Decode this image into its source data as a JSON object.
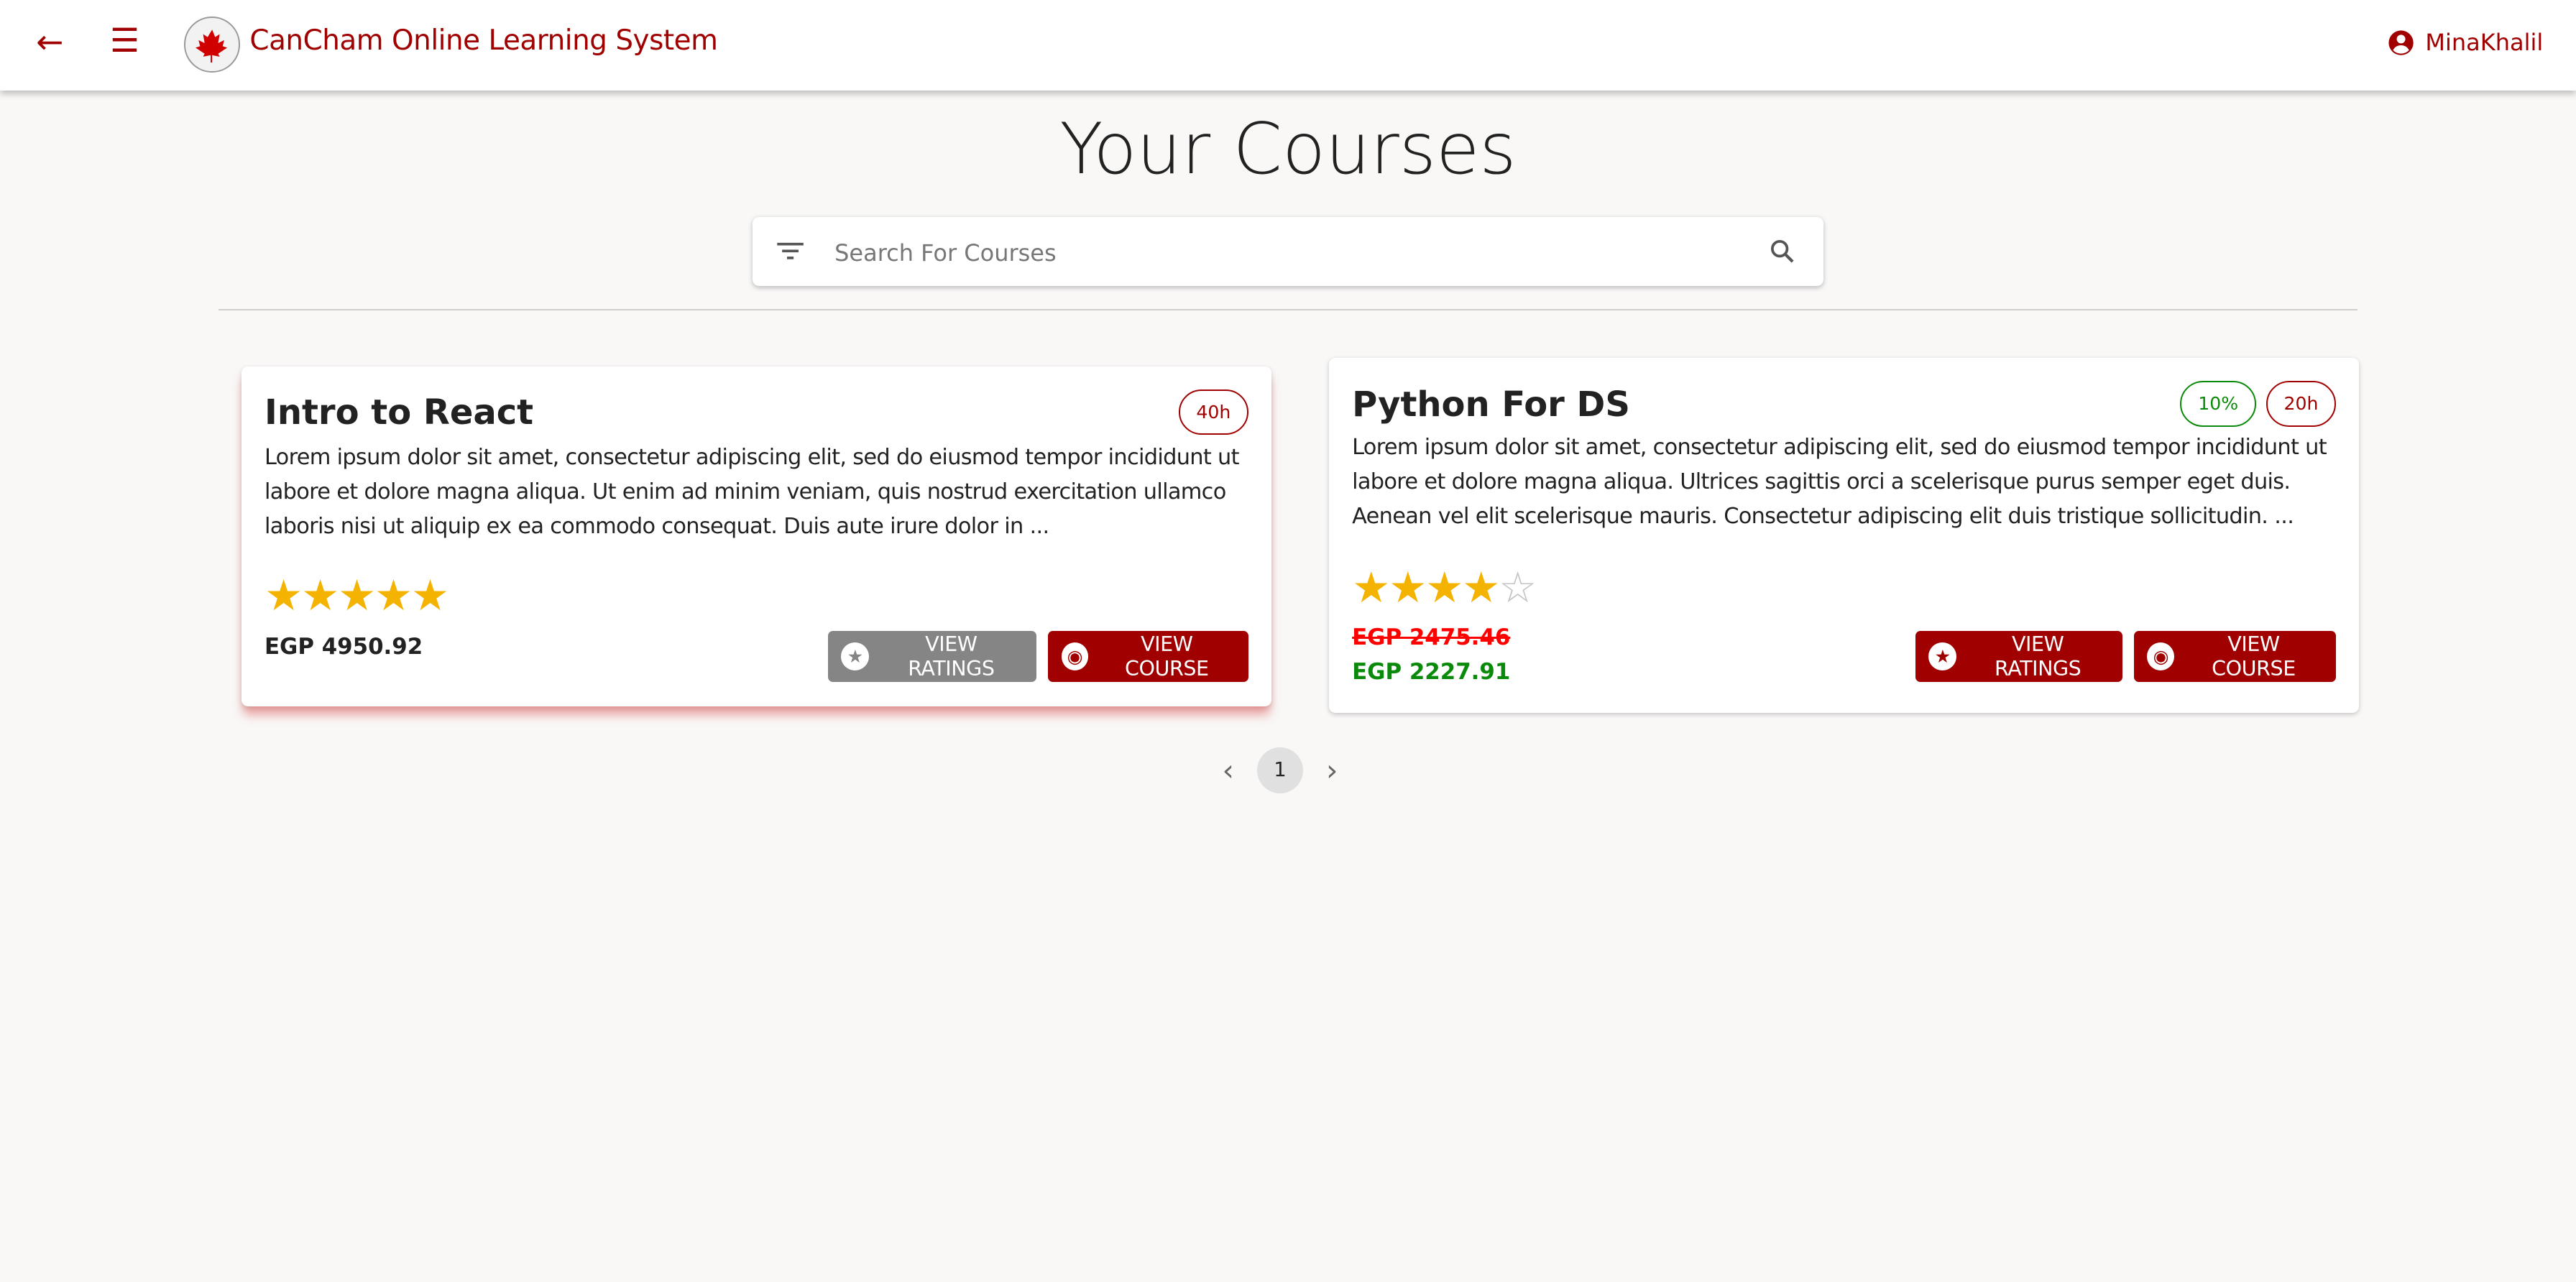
{
  "header": {
    "title": "CanCham Online Learning System",
    "logo_text": "CanCham",
    "user": "MinaKhalil",
    "icons": [
      "arrow-back-icon",
      "menu-icon",
      "account-circle-icon"
    ]
  },
  "page": {
    "title": "Your Courses",
    "search_placeholder": "Search For Courses",
    "search_value": ""
  },
  "courses": [
    {
      "title": "Intro to React",
      "hours": "40h",
      "description": "Lorem ipsum dolor sit amet, consectetur adipiscing elit, sed do eiusmod tempor incididunt ut labore et dolore magna aliqua. Ut enim ad minim veniam, quis nostrud exercitation ullamco laboris nisi ut aliquip ex ea commodo consequat. Duis aute irure dolor in ...",
      "rating": 5,
      "price": "EGP 4950.92",
      "view_ratings": "VIEW RATINGS",
      "view_course": "VIEW COURSE"
    },
    {
      "title": "Python For DS",
      "discount": "10%",
      "hours": "20h",
      "description": "Lorem ipsum dolor sit amet, consectetur adipiscing elit, sed do eiusmod tempor incididunt ut labore et dolore magna aliqua. Ultrices sagittis orci a scelerisque purus semper eget duis. Aenean vel elit scelerisque mauris. Consectetur adipiscing elit duis tristique sollicitudin. ...",
      "rating": 4,
      "old_price": "EGP 2475.46",
      "price": "EGP 2227.91",
      "view_ratings": "VIEW RATINGS",
      "view_course": "VIEW COURSE"
    }
  ],
  "pagination": {
    "current": "1",
    "prev": "‹",
    "next": "›"
  },
  "colors": {
    "brand": "#a00000",
    "star": "#f5b301",
    "discount": "#0a8a0a",
    "strike": "#ff0000"
  }
}
